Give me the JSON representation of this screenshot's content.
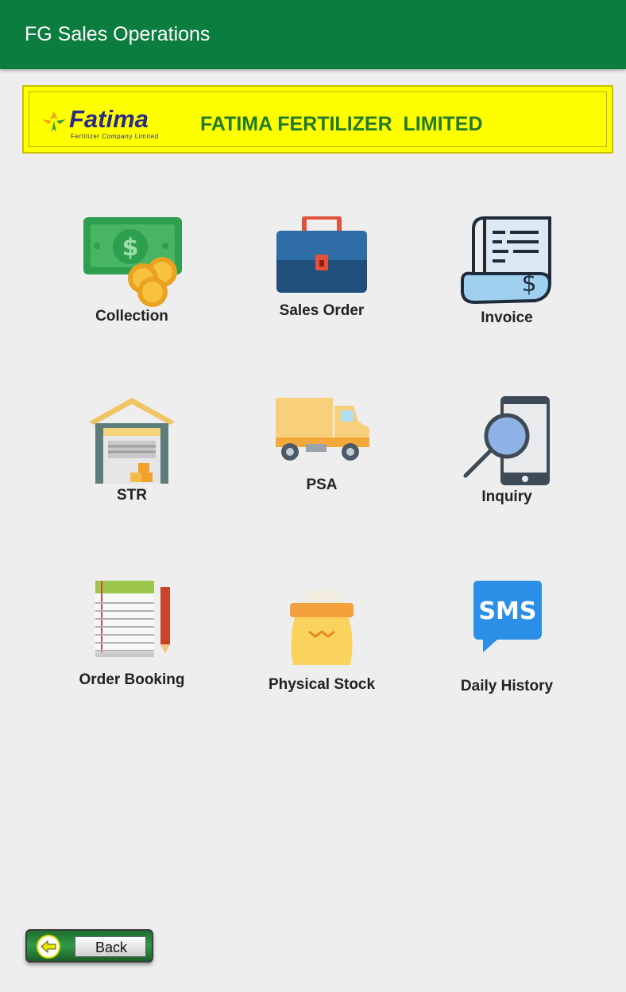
{
  "app": {
    "title": "FG Sales Operations"
  },
  "banner": {
    "logo_text": "Fatima",
    "logo_subtext": "Fertilizer Company Limited",
    "title": "FATIMA FERTILIZER  LIMITED"
  },
  "menu": [
    {
      "label": "Collection",
      "icon": "money-coins-icon"
    },
    {
      "label": "Sales Order",
      "icon": "briefcase-icon"
    },
    {
      "label": "Invoice",
      "icon": "receipt-icon"
    },
    {
      "label": "STR",
      "icon": "warehouse-icon"
    },
    {
      "label": "PSA",
      "icon": "truck-icon"
    },
    {
      "label": "Inquiry",
      "icon": "phone-search-icon"
    },
    {
      "label": "Order Booking",
      "icon": "notebook-pencil-icon"
    },
    {
      "label": "Physical Stock",
      "icon": "sack-icon"
    },
    {
      "label": "Daily History",
      "icon": "sms-icon"
    }
  ],
  "footer": {
    "back_label": "Back"
  },
  "colors": {
    "appbar": "#0b7d3e",
    "banner": "#ffff00",
    "banner_text": "#1f7a2a"
  }
}
